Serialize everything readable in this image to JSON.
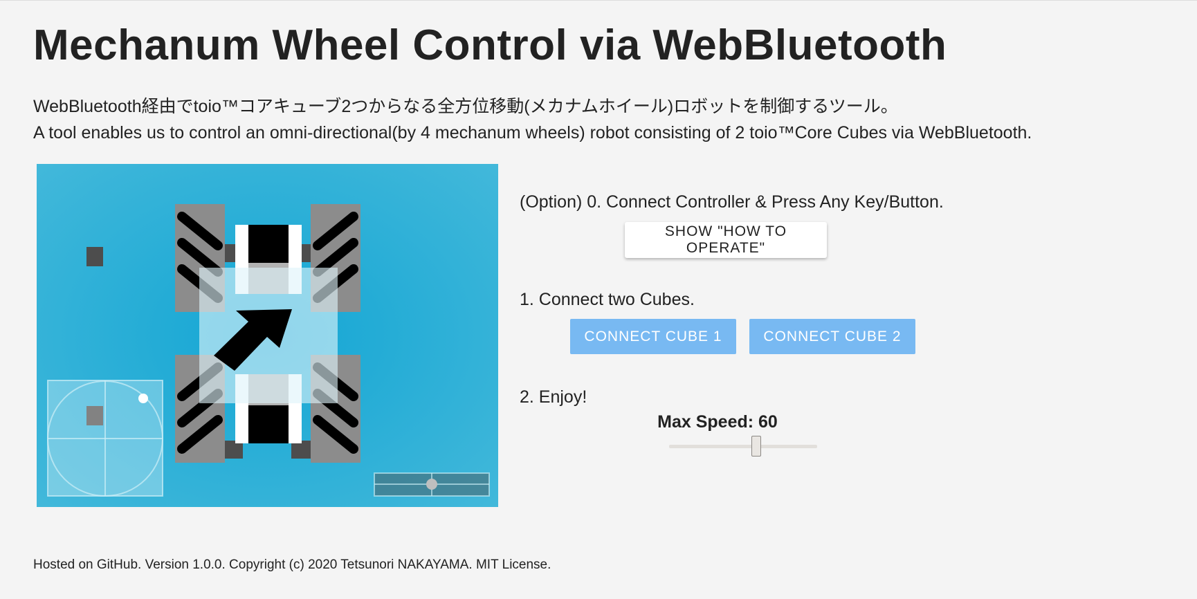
{
  "page": {
    "title": "Mechanum Wheel Control via WebBluetooth",
    "description_ja": "WebBluetooth経由でtoio™コアキューブ2つからなる全方位移動(メカナムホイール)ロボットを制御するツール。",
    "description_en": "A tool enables us to control an omni-directional(by 4 mechanum wheels) robot consisting of 2 toio™Core Cubes via WebBluetooth."
  },
  "controls": {
    "step0_label": "(Option) 0. Connect Controller & Press Any Key/Button.",
    "howto_button": "SHOW \"HOW TO OPERATE\"",
    "step1_label": "1. Connect two Cubes.",
    "connect_cube1": "CONNECT CUBE 1",
    "connect_cube2": "CONNECT CUBE 2",
    "step2_label": "2. Enjoy!",
    "max_speed_label": "Max Speed: 60",
    "max_speed": {
      "value": 60,
      "fraction": 0.59
    }
  },
  "footer": {
    "text": "Hosted on GitHub. Version 1.0.0. Copyright (c) 2020 Tetsunori NAKAYAMA. MIT License."
  },
  "colors": {
    "background": "#f4f4f4",
    "visual_background": "#24b1d9",
    "connect_button": "#78b9f2",
    "text": "#222222"
  },
  "icons": {
    "direction_arrow": "up-right-arrow-icon",
    "joystick": "joystick-pad",
    "rotation_slider": "rotation-slider"
  }
}
